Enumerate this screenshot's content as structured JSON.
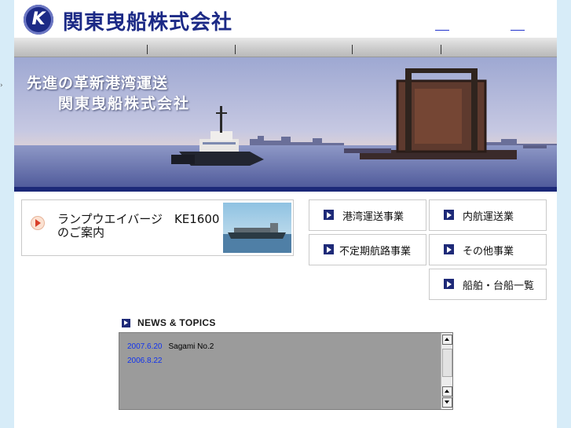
{
  "header": {
    "company_name": "関東曳船株式会社",
    "logo_letter": "K",
    "top_links": [
      "",
      ""
    ]
  },
  "nav": {
    "items": [
      "",
      "",
      "",
      "",
      ""
    ]
  },
  "banner": {
    "line1": "先進の革新港湾運送",
    "line2": "関東曳船株式会社"
  },
  "feature": {
    "line1": "ランプウエイバージ　KE1600",
    "line2": "のご案内",
    "icon": "play-circle-icon"
  },
  "menu": {
    "harbor": "港湾運送事業",
    "coastal": "内航運送業",
    "irregular": "不定期航路事業",
    "other": "その他事業",
    "fleet": "船舶・台船一覧"
  },
  "news": {
    "heading": "NEWS & TOPICS",
    "items": [
      {
        "date": "2007.6.20",
        "title": "Sagami No.2"
      },
      {
        "date": "2006.8.22",
        "title": ""
      }
    ]
  },
  "colors": {
    "brand_navy": "#1c2a86",
    "news_bg": "#9b9b9b",
    "link_blue": "#1133ee",
    "page_bg": "#d7ecf8"
  }
}
